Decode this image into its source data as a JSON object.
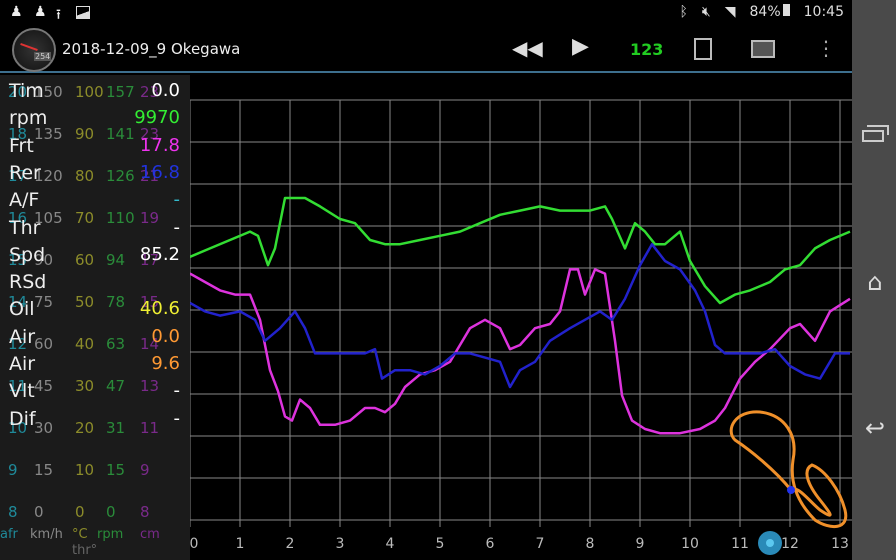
{
  "status_bar": {
    "icons": [
      "chess-pawn-icon",
      "chess-pawn-icon",
      "upload-icon",
      "image-icon"
    ],
    "battery": "84%",
    "time": "10:45"
  },
  "app_bar": {
    "title": "2018-12-09_9 Okegawa",
    "gauge_value": "254",
    "digits_button": "123"
  },
  "readouts": [
    {
      "label": "Tim",
      "value": "0.0",
      "color": "#ffffff"
    },
    {
      "label": "rpm",
      "value": "9970",
      "color": "#33ee33"
    },
    {
      "label": "Frt",
      "value": "17.8",
      "color": "#ee33ee"
    },
    {
      "label": "Rer",
      "value": "16.8",
      "color": "#2233dd"
    },
    {
      "label": "A/F",
      "value": "-",
      "color": "#33bbcc"
    },
    {
      "label": "Thr",
      "value": "-",
      "color": "#ffffff"
    },
    {
      "label": "Spd",
      "value": "85.2",
      "color": "#ffffff"
    },
    {
      "label": "RSd",
      "value": "",
      "color": "#ffffff"
    },
    {
      "label": "Oil",
      "value": "40.6",
      "color": "#eeee33"
    },
    {
      "label": "Air",
      "value": "0.0",
      "color": "#ff9933"
    },
    {
      "label": "Air",
      "value": "9.6",
      "color": "#ff9933"
    },
    {
      "label": "Vlt",
      "value": "-",
      "color": "#ffffff"
    },
    {
      "label": "Dif",
      "value": "-",
      "color": "#ffffff"
    }
  ],
  "scales": {
    "afr": [
      "20",
      "18",
      "17",
      "16",
      "15",
      "14",
      "12",
      "11",
      "10",
      "9",
      "8"
    ],
    "kmh": [
      "150",
      "135",
      "120",
      "105",
      "90",
      "75",
      "60",
      "45",
      "30",
      "15",
      "0"
    ],
    "temp": [
      "100",
      "90",
      "80",
      "70",
      "60",
      "50",
      "40",
      "30",
      "20",
      "10",
      "0"
    ],
    "rpm": [
      "157",
      "141",
      "126",
      "110",
      "94",
      "78",
      "63",
      "47",
      "31",
      "15",
      "0"
    ],
    "cm": [
      "23",
      "23",
      "21",
      "19",
      "17",
      "15",
      "14",
      "13",
      "11",
      "9",
      "8"
    ],
    "units": [
      "afr",
      "km/h",
      "°C",
      "rpm",
      "cm"
    ],
    "units2": "thr°"
  },
  "chart_data": {
    "type": "line",
    "x_ticks": [
      "0",
      "1",
      "2",
      "3",
      "4",
      "5",
      "6",
      "7",
      "8",
      "9",
      "10",
      "11",
      "12",
      "13"
    ],
    "xlim": [
      0,
      13
    ],
    "ylim": [
      0,
      100
    ],
    "grid": true,
    "cursor_x": 11.6,
    "series": [
      {
        "name": "rpm",
        "color": "#33dd33",
        "points": [
          [
            0,
            61
          ],
          [
            0.4,
            63
          ],
          [
            0.8,
            65
          ],
          [
            1.2,
            67
          ],
          [
            1.36,
            66
          ],
          [
            1.56,
            59
          ],
          [
            1.7,
            63
          ],
          [
            1.9,
            75
          ],
          [
            2.04,
            75
          ],
          [
            2.3,
            75
          ],
          [
            2.6,
            73
          ],
          [
            3,
            70
          ],
          [
            3.3,
            69
          ],
          [
            3.6,
            65
          ],
          [
            3.9,
            64
          ],
          [
            4.2,
            64
          ],
          [
            4.6,
            65
          ],
          [
            5,
            66
          ],
          [
            5.4,
            67
          ],
          [
            5.8,
            69
          ],
          [
            6.2,
            71
          ],
          [
            6.6,
            72
          ],
          [
            7,
            73
          ],
          [
            7.4,
            72
          ],
          [
            7.7,
            72
          ],
          [
            8,
            72
          ],
          [
            8.3,
            73
          ],
          [
            8.44,
            70
          ],
          [
            8.7,
            63
          ],
          [
            8.9,
            69
          ],
          [
            9.1,
            67
          ],
          [
            9.3,
            64
          ],
          [
            9.5,
            64
          ],
          [
            9.8,
            67
          ],
          [
            10,
            60
          ],
          [
            10.3,
            54
          ],
          [
            10.6,
            50
          ],
          [
            10.9,
            52
          ],
          [
            11.2,
            53
          ],
          [
            11.6,
            55
          ],
          [
            11.9,
            58
          ],
          [
            12.2,
            59
          ],
          [
            12.5,
            63
          ],
          [
            12.8,
            65
          ],
          [
            13.2,
            67
          ]
        ]
      },
      {
        "name": "Frt",
        "color": "#dd33dd",
        "points": [
          [
            0,
            57
          ],
          [
            0.3,
            55
          ],
          [
            0.6,
            53
          ],
          [
            0.9,
            52
          ],
          [
            1.2,
            52
          ],
          [
            1.4,
            46
          ],
          [
            1.6,
            34
          ],
          [
            1.76,
            29
          ],
          [
            1.9,
            23
          ],
          [
            2.04,
            22
          ],
          [
            2.2,
            27
          ],
          [
            2.4,
            25
          ],
          [
            2.6,
            21
          ],
          [
            2.9,
            21
          ],
          [
            3.2,
            22
          ],
          [
            3.5,
            25
          ],
          [
            3.7,
            25
          ],
          [
            3.9,
            24
          ],
          [
            4.1,
            26
          ],
          [
            4.3,
            30
          ],
          [
            4.6,
            33
          ],
          [
            4.9,
            34
          ],
          [
            5.2,
            36
          ],
          [
            5.4,
            40
          ],
          [
            5.6,
            44
          ],
          [
            5.9,
            46
          ],
          [
            6.2,
            44
          ],
          [
            6.4,
            39
          ],
          [
            6.6,
            40
          ],
          [
            6.9,
            44
          ],
          [
            7.2,
            45
          ],
          [
            7.4,
            48
          ],
          [
            7.6,
            58
          ],
          [
            7.76,
            58
          ],
          [
            7.9,
            52
          ],
          [
            8.1,
            58
          ],
          [
            8.3,
            57
          ],
          [
            8.5,
            41
          ],
          [
            8.64,
            28
          ],
          [
            8.84,
            22
          ],
          [
            9.1,
            20
          ],
          [
            9.4,
            19
          ],
          [
            9.8,
            19
          ],
          [
            10.2,
            20
          ],
          [
            10.5,
            22
          ],
          [
            10.7,
            25
          ],
          [
            11,
            32
          ],
          [
            11.3,
            36
          ],
          [
            11.6,
            39
          ],
          [
            12,
            44
          ],
          [
            12.2,
            45
          ],
          [
            12.5,
            41
          ],
          [
            12.8,
            48
          ],
          [
            13.2,
            51
          ]
        ]
      },
      {
        "name": "Rer",
        "color": "#2222cc",
        "points": [
          [
            0,
            50
          ],
          [
            0.3,
            48
          ],
          [
            0.6,
            47
          ],
          [
            1,
            48
          ],
          [
            1.3,
            46
          ],
          [
            1.5,
            41
          ],
          [
            1.8,
            44
          ],
          [
            2.1,
            48
          ],
          [
            2.3,
            44
          ],
          [
            2.5,
            38
          ],
          [
            2.8,
            38
          ],
          [
            3.1,
            38
          ],
          [
            3.5,
            38
          ],
          [
            3.7,
            39
          ],
          [
            3.84,
            32
          ],
          [
            4.1,
            34
          ],
          [
            4.4,
            34
          ],
          [
            4.7,
            33
          ],
          [
            5,
            35
          ],
          [
            5.3,
            38
          ],
          [
            5.6,
            38
          ],
          [
            5.9,
            37
          ],
          [
            6.2,
            36
          ],
          [
            6.4,
            30
          ],
          [
            6.6,
            34
          ],
          [
            6.9,
            36
          ],
          [
            7.2,
            41
          ],
          [
            7.6,
            44
          ],
          [
            7.9,
            46
          ],
          [
            8.2,
            48
          ],
          [
            8.44,
            46
          ],
          [
            8.7,
            51
          ],
          [
            9,
            59
          ],
          [
            9.24,
            64
          ],
          [
            9.5,
            60
          ],
          [
            9.8,
            58
          ],
          [
            10.1,
            53
          ],
          [
            10.3,
            48
          ],
          [
            10.5,
            40
          ],
          [
            10.7,
            38
          ],
          [
            11,
            38
          ],
          [
            11.4,
            38
          ],
          [
            11.7,
            39
          ],
          [
            12,
            35
          ],
          [
            12.3,
            33
          ],
          [
            12.6,
            32
          ],
          [
            12.9,
            38
          ],
          [
            13.2,
            38
          ]
        ]
      }
    ]
  }
}
